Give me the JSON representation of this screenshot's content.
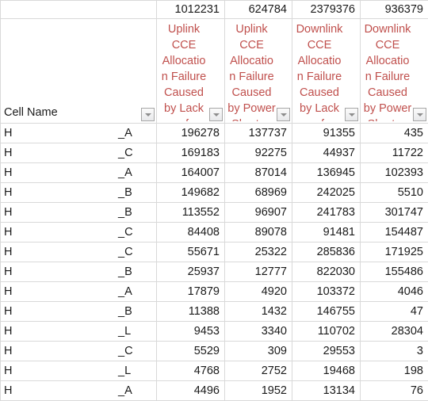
{
  "table": {
    "row_label_header": "Cell Name",
    "columns": [
      {
        "header": "Uplink CCE Allocation Failure Caused by Lack of Resource",
        "total": "1012231",
        "filter_icon": "filter-dropdown-icon"
      },
      {
        "header": "Uplink CCE Allocation Failure Caused by Power Shortag",
        "total": "624784",
        "filter_icon": "filter-dropdown-icon"
      },
      {
        "header": "Downlink CCE Allocation Failure Caused by Lack of Resourc",
        "total": "2379376",
        "filter_icon": "filter-dropdown-icon"
      },
      {
        "header": "Downlink CCE Allocation Failure Caused by Power Shortag",
        "total": "936379",
        "filter_icon": "filter-dropdown-icon"
      }
    ],
    "row_filter_icon": "filter-dropdown-icon",
    "rows": [
      {
        "name_prefix": "H",
        "name_suffix": "_A",
        "values": [
          "196278",
          "137737",
          "91355",
          "435"
        ]
      },
      {
        "name_prefix": "H",
        "name_suffix": "_C",
        "values": [
          "169183",
          "92275",
          "44937",
          "11722"
        ]
      },
      {
        "name_prefix": "H",
        "name_suffix": "_A",
        "values": [
          "164007",
          "87014",
          "136945",
          "102393"
        ]
      },
      {
        "name_prefix": "H",
        "name_suffix": "_B",
        "values": [
          "149682",
          "68969",
          "242025",
          "5510"
        ]
      },
      {
        "name_prefix": "H",
        "name_suffix": "_B",
        "values": [
          "113552",
          "96907",
          "241783",
          "301747"
        ]
      },
      {
        "name_prefix": "H",
        "name_suffix": "_C",
        "values": [
          "84408",
          "89078",
          "91481",
          "154487"
        ]
      },
      {
        "name_prefix": "H",
        "name_suffix": "_C",
        "values": [
          "55671",
          "25322",
          "285836",
          "171925"
        ]
      },
      {
        "name_prefix": "H",
        "name_suffix": "_B",
        "values": [
          "25937",
          "12777",
          "822030",
          "155486"
        ]
      },
      {
        "name_prefix": "H",
        "name_suffix": "_A",
        "values": [
          "17879",
          "4920",
          "103372",
          "4046"
        ]
      },
      {
        "name_prefix": "H",
        "name_suffix": "_B",
        "values": [
          "11388",
          "1432",
          "146755",
          "47"
        ]
      },
      {
        "name_prefix": "H",
        "name_suffix": "_L",
        "values": [
          "9453",
          "3340",
          "110702",
          "28304"
        ]
      },
      {
        "name_prefix": "H",
        "name_suffix": "_C",
        "values": [
          "5529",
          "309",
          "29553",
          "3"
        ]
      },
      {
        "name_prefix": "H",
        "name_suffix": "_L",
        "values": [
          "4768",
          "2752",
          "19468",
          "198"
        ]
      },
      {
        "name_prefix": "H",
        "name_suffix": "_A",
        "values": [
          "4496",
          "1952",
          "13134",
          "76"
        ]
      }
    ]
  },
  "colors": {
    "header_text": "#C0504D",
    "body_text": "#1a1a1a",
    "gridline": "#d9d9d9"
  }
}
